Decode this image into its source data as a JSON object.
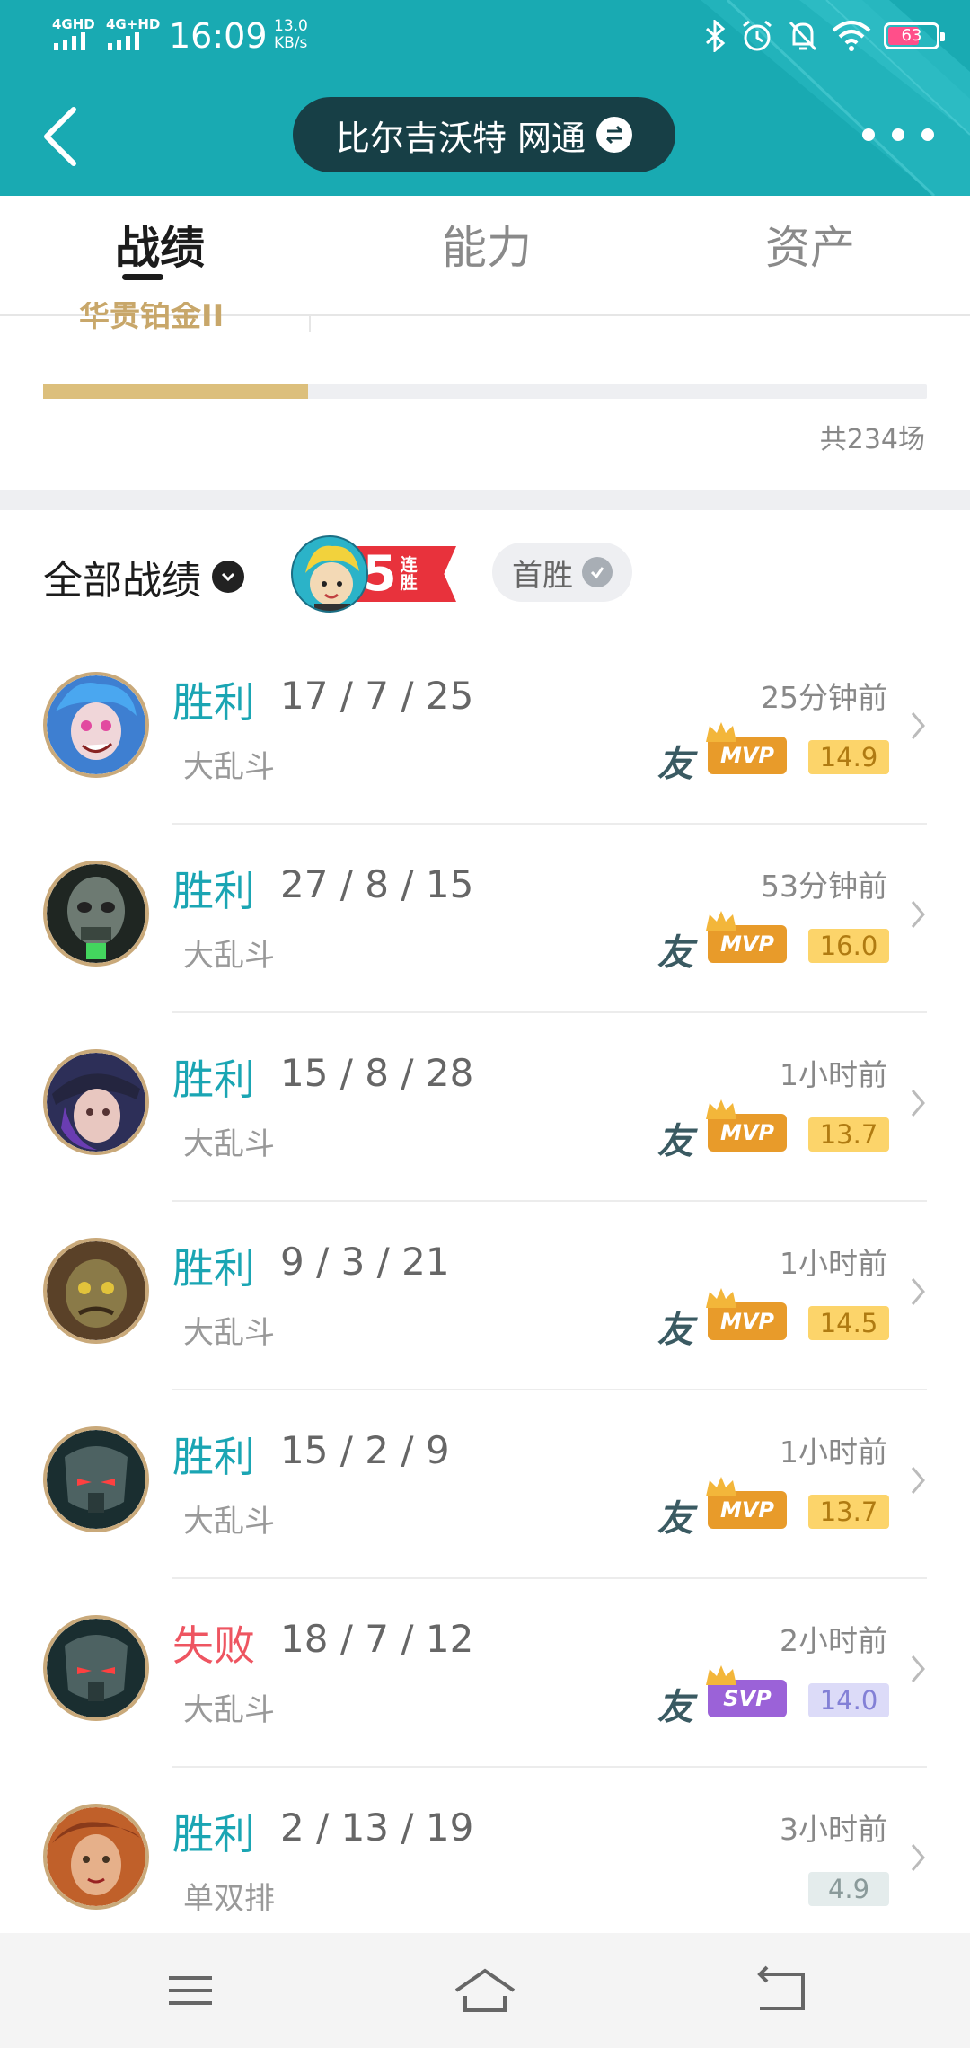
{
  "status_bar": {
    "signal_1": "4GHD",
    "signal_2": "4G+HD",
    "time": "16:09",
    "speed_value": "13.0",
    "speed_unit": "KB/s",
    "battery": "63"
  },
  "header": {
    "server_name": "比尔吉沃特 网通",
    "colors": {
      "bar": "#19aab2",
      "pill": "#173f46"
    }
  },
  "tabs": [
    {
      "label": "战绩",
      "active": true
    },
    {
      "label": "能力",
      "active": false
    },
    {
      "label": "资产",
      "active": false
    }
  ],
  "rank": {
    "label": "华贵铂金II",
    "progress_fraction": 0.3,
    "total_games": "共234场"
  },
  "filter": {
    "all_label": "全部战绩",
    "streak_count": "5",
    "streak_word": "连胜",
    "first_win_label": "首胜"
  },
  "matches": [
    {
      "result": "胜利",
      "result_type": "win",
      "kda": "17 / 7 / 25",
      "mode": "大乱斗",
      "time": "25分钟前",
      "friend": "友",
      "award": "MVP",
      "score": "14.9",
      "score_style": "gold"
    },
    {
      "result": "胜利",
      "result_type": "win",
      "kda": "27 / 8 / 15",
      "mode": "大乱斗",
      "time": "53分钟前",
      "friend": "友",
      "award": "MVP",
      "score": "16.0",
      "score_style": "gold"
    },
    {
      "result": "胜利",
      "result_type": "win",
      "kda": "15 / 8 / 28",
      "mode": "大乱斗",
      "time": "1小时前",
      "friend": "友",
      "award": "MVP",
      "score": "13.7",
      "score_style": "gold"
    },
    {
      "result": "胜利",
      "result_type": "win",
      "kda": "9 / 3 / 21",
      "mode": "大乱斗",
      "time": "1小时前",
      "friend": "友",
      "award": "MVP",
      "score": "14.5",
      "score_style": "gold"
    },
    {
      "result": "胜利",
      "result_type": "win",
      "kda": "15 / 2 / 9",
      "mode": "大乱斗",
      "time": "1小时前",
      "friend": "友",
      "award": "MVP",
      "score": "13.7",
      "score_style": "gold"
    },
    {
      "result": "失败",
      "result_type": "lose",
      "kda": "18 / 7 / 12",
      "mode": "大乱斗",
      "time": "2小时前",
      "friend": "友",
      "award": "SVP",
      "score": "14.0",
      "score_style": "purple"
    },
    {
      "result": "胜利",
      "result_type": "win",
      "kda": "2 / 13 / 19",
      "mode": "单双排",
      "time": "3小时前",
      "friend": "",
      "award": "",
      "score": "4.9",
      "score_style": "plain"
    }
  ]
}
